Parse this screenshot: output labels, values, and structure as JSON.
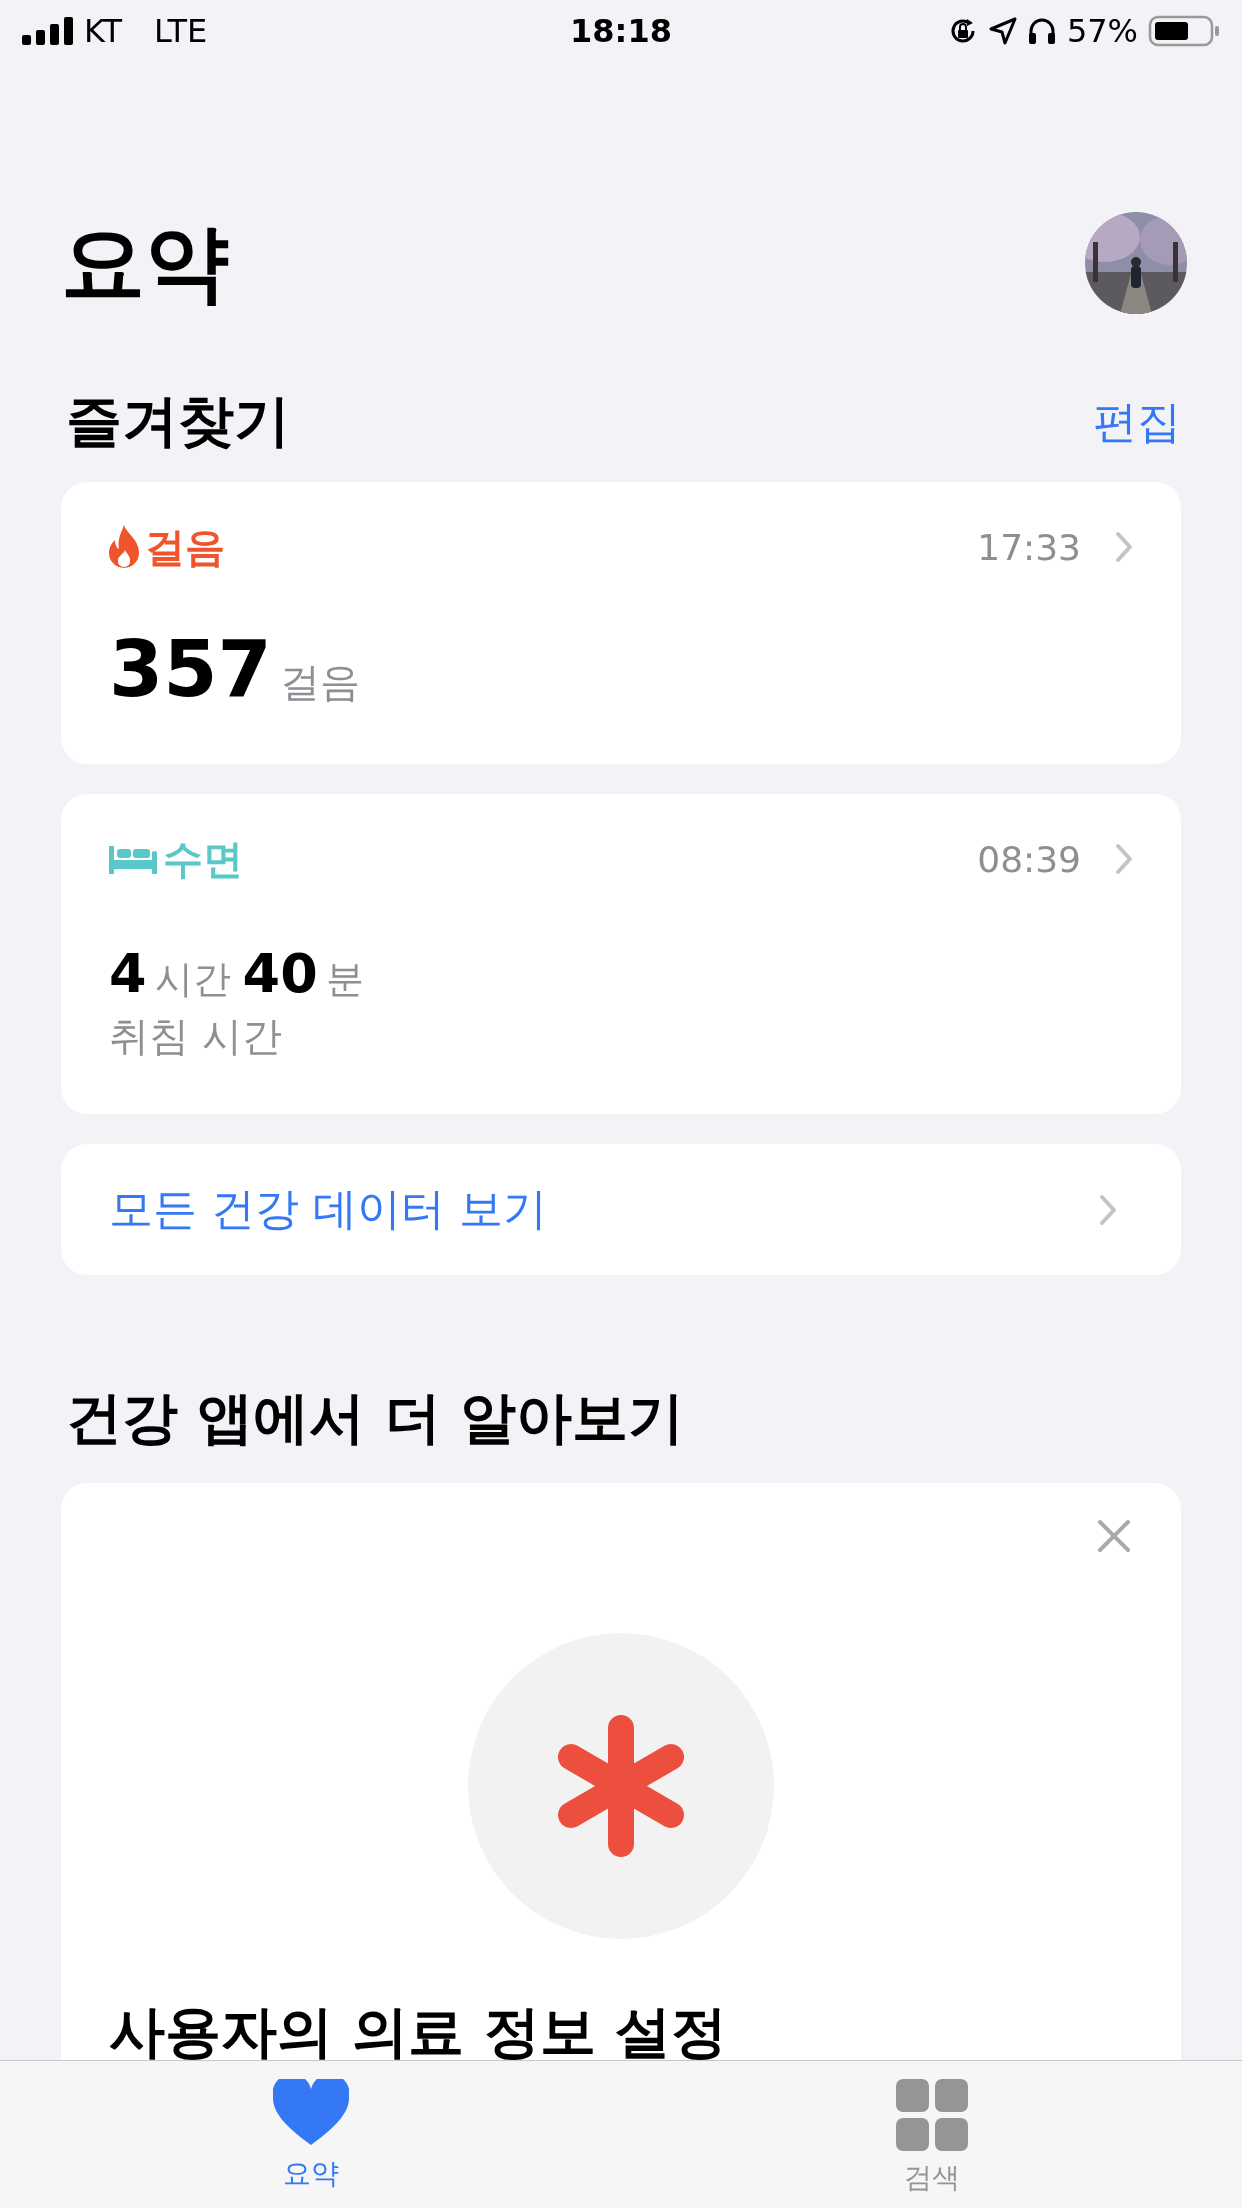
{
  "status_bar": {
    "carrier": "KT",
    "network": "LTE",
    "time": "18:18",
    "battery": "57%"
  },
  "header": {
    "title": "요약"
  },
  "favorites": {
    "title": "즐겨찾기",
    "edit": "편집",
    "cards": [
      {
        "kind": "steps",
        "color": "#f0542d",
        "label": "걸음",
        "time": "17:33",
        "parts": [
          {
            "value": "357",
            "unit": "걸음"
          }
        ]
      },
      {
        "kind": "sleep",
        "color": "#5ac8c8",
        "label": "수면",
        "time": "08:39",
        "parts": [
          {
            "value": "4",
            "unit": "시간"
          },
          {
            "value": "40",
            "unit": "분"
          }
        ],
        "caption": "취침 시간"
      }
    ],
    "all_data": "모든 건강 데이터 보기"
  },
  "learn": {
    "title": "건강 앱에서 더 알아보기",
    "card": {
      "title": "사용자의 의료 정보 설정"
    }
  },
  "tabs": [
    {
      "kind": "summary",
      "label": "요약",
      "selected": true
    },
    {
      "kind": "browse",
      "label": "검색",
      "selected": false
    }
  ]
}
